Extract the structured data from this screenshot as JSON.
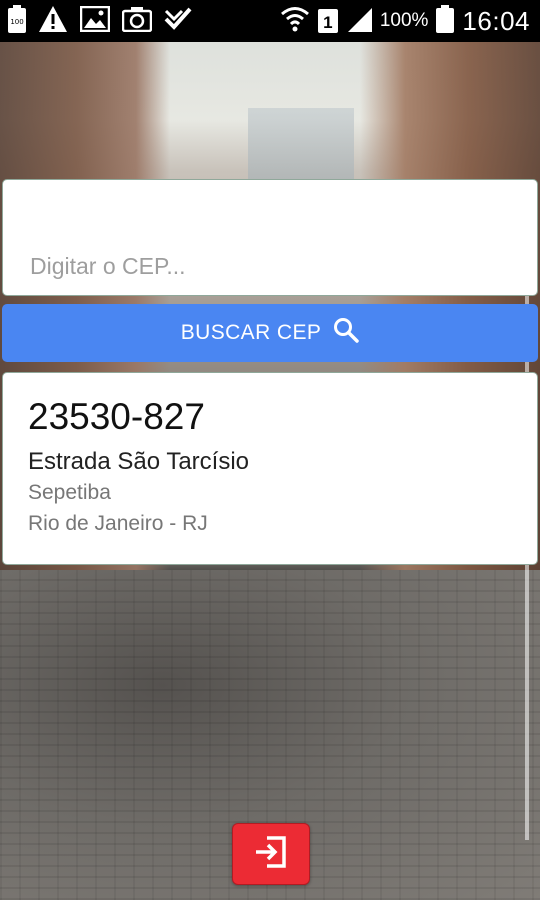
{
  "status_bar": {
    "battery_small_label": "100",
    "sim_label": "1",
    "battery_percent": "100%",
    "time": "16:04",
    "icons": [
      "battery-icon",
      "warning-icon",
      "image-icon",
      "camera-icon",
      "check-icon",
      "wifi-icon",
      "sim-icon",
      "signal-icon",
      "battery-icon"
    ]
  },
  "search": {
    "placeholder": "Digitar o CEP...",
    "value": "",
    "button_label": "BUSCAR CEP",
    "button_icon": "search-icon"
  },
  "result": {
    "cep": "23530-827",
    "street": "Estrada São Tarcísio",
    "district": "Sepetiba",
    "city_state": "Rio de Janeiro - RJ"
  },
  "footer": {
    "exit_icon": "exit-icon"
  },
  "colors": {
    "button_blue": "#4a86f2",
    "exit_red": "#ec2b34",
    "card_border": "#8fa89a"
  }
}
